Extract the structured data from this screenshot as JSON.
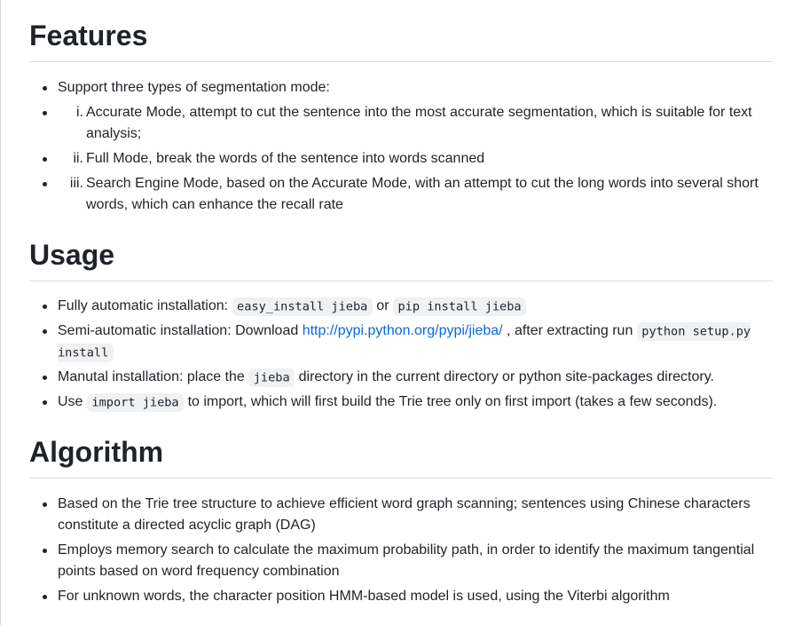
{
  "features": {
    "heading": "Features",
    "intro": "Support three types of segmentation mode:",
    "modes": [
      {
        "num": "i.",
        "text": "Accurate Mode, attempt to cut the sentence into the most accurate segmentation, which is suitable for text analysis;"
      },
      {
        "num": "ii.",
        "text": "Full Mode, break the words of the sentence into words scanned"
      },
      {
        "num": "iii.",
        "text": "Search Engine Mode, based on the Accurate Mode, with an attempt to cut the long words into several short words, which can enhance the recall rate"
      }
    ]
  },
  "usage": {
    "heading": "Usage",
    "item1": {
      "text1": "Fully automatic installation: ",
      "code1": "easy_install jieba",
      "text2": " or ",
      "code2": "pip install jieba"
    },
    "item2": {
      "text1": "Semi-automatic installation: Download ",
      "link": "http://pypi.python.org/pypi/jieba/",
      "text2": " , after extracting run ",
      "code1": "python setup.py install"
    },
    "item3": {
      "text1": "Manutal installation: place the ",
      "code1": "jieba",
      "text2": " directory in the current directory or python site-packages directory."
    },
    "item4": {
      "text1": "Use ",
      "code1": "import jieba",
      "text2": " to import, which will first build the Trie tree only on first import (takes a few seconds)."
    }
  },
  "algorithm": {
    "heading": "Algorithm",
    "items": [
      "Based on the Trie tree structure to achieve efficient word graph scanning; sentences using Chinese characters constitute a directed acyclic graph (DAG)",
      "Employs memory search to calculate the maximum probability path, in order to identify the maximum tangential points based on word frequency combination",
      "For unknown words, the character position HMM-based model is used, using the Viterbi algorithm"
    ]
  }
}
